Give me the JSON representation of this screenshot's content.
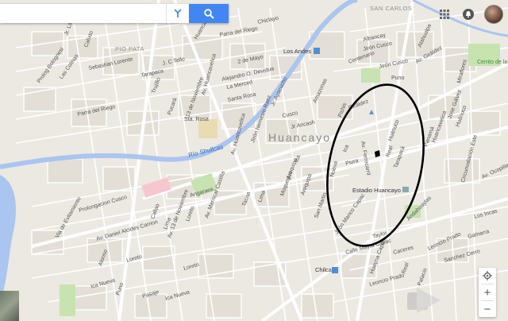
{
  "search": {
    "value": "",
    "placeholder": ""
  },
  "map": {
    "city_label": "Huancayo",
    "district_labels": [
      "PIO PATA",
      "SAN CARLOS"
    ],
    "river_label": "Río Shullcas",
    "pois": [
      "Los Andes",
      "Estadio Huancayo",
      "Chilca",
      "Cerrito de la"
    ],
    "streets": [
      "Jr. Libertad",
      "Parra del Riego",
      "Huancas",
      "Chiclayo",
      "Calixto",
      "Sebastian Lorente",
      "Prolog Bolognesi",
      "Las Colinas",
      "Tarapaca",
      "Parra del Riego",
      "J. C Tello",
      "Trujillo",
      "Pucará",
      "13 de Noviembre",
      "Alejandro O. Deustua",
      "2 de Mayo",
      "La Merced",
      "Santa Rosa",
      "Sta. Rosa",
      "Jr. Ayacucho",
      "Cusco",
      "Jr Ancash",
      "Amazonas",
      "Jirón Cusco",
      "Puno",
      "Centenario",
      "Jirón Cusco",
      "Albancay",
      "Pichis",
      "Giráldez",
      "Atahualpa",
      "Ica",
      "Piura",
      "Huánuco",
      "Av. Ferrocarril",
      "Tarapacá",
      "Real",
      "Arequipa",
      "Moquegua",
      "Av. Giráldez",
      "Panamá",
      "Huancavelica",
      "Huánuco",
      "Jose Gálvez",
      "Miraflores",
      "Circunvalación Este",
      "Av. Ocopilla",
      "Los Incas",
      "Gamarra",
      "Sanchez Cerro",
      "Av. Daniel Alcides Carrion",
      "Callao",
      "Lima",
      "Loreto",
      "Tacna",
      "Lima",
      "Av. Huancavelica",
      "Jirón Nemesio Raez",
      "Av. Mariscal Castilla",
      "Av. Huancavelica",
      "Arequipa",
      "Ica",
      "Prolongacion Cusco",
      "Via de Evitamiento",
      "Calle Mayta Capac",
      "Leoncio Prado",
      "Loreto",
      "Ica Nueva",
      "Ica Nueva",
      "Caceres",
      "Leoncio Prado",
      "Jirón Manco Capac",
      "Taylor",
      "Loreto",
      "Pasaje",
      "Alonso",
      "Puno",
      "Angaraes",
      "San Martin",
      "Huayna Capac",
      "Palacio",
      "Nueva",
      "Real",
      "Andahuaylas",
      "Av. 13 de Noviembre",
      "Av. Calmell del Solar"
    ],
    "colors": {
      "land": "#ece9e2",
      "block": "#e2ded6",
      "road": "#ffffff",
      "major_road": "#f8f8f8",
      "river": "#a9c5f0",
      "park": "#c6e3b0",
      "highlight_ellipse": "#000000",
      "transit": "#ff7b9c"
    }
  },
  "controls": {
    "zoom_in": "+",
    "zoom_out": "−",
    "apps_icon": "apps-grid",
    "notifications_icon": "notifications",
    "search_icon": "magnifier",
    "directions_icon": "directions"
  }
}
